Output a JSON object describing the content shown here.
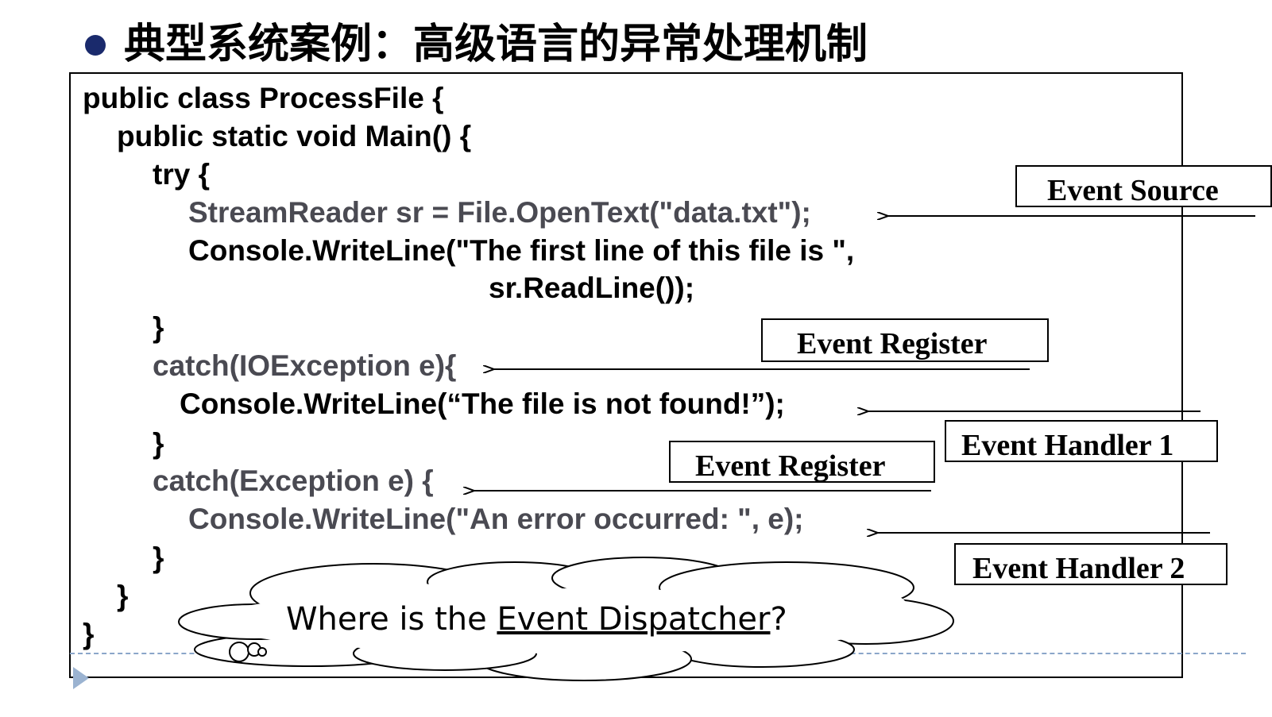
{
  "title": "典型系统案例：高级语言的异常处理机制",
  "code": {
    "line1": "public class ProcessFile {",
    "line2": "public static void Main() {",
    "line3": "try {",
    "line4": "StreamReader sr = File.OpenText(\"data.txt\");",
    "line5": "Console.WriteLine(\"The first line of this file is \",",
    "line6": "sr.ReadLine());",
    "line7": "}",
    "line8": "catch(IOException e){",
    "line9": "Console.WriteLine(“The file is not found!”);",
    "line10": "}",
    "line11": "catch(Exception e) {",
    "line12": "Console.WriteLine(\"An error occurred: \", e);",
    "line13": "}",
    "line14": "}",
    "line15": "}"
  },
  "labels": {
    "event_source": "Event Source",
    "event_register_1": "Event Register",
    "event_handler_1": "Event Handler 1",
    "event_register_2": "Event Register",
    "event_handler_2": "Event Handler 2"
  },
  "cloud": {
    "prefix": "Where is the ",
    "underlined": "Event Dispatcher",
    "suffix": "?"
  }
}
